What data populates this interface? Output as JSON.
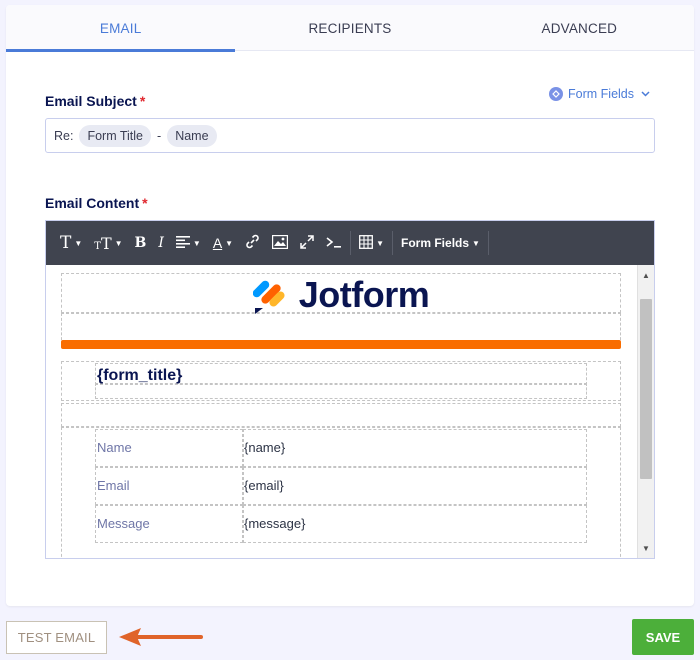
{
  "tabs": [
    {
      "label": "EMAIL",
      "active": true
    },
    {
      "label": "RECIPIENTS",
      "active": false
    },
    {
      "label": "ADVANCED",
      "active": false
    }
  ],
  "subject": {
    "label": "Email Subject",
    "required_mark": "*",
    "form_fields_label": "Form Fields",
    "prefix": "Re:",
    "chip_1": "Form Title",
    "separator": "-",
    "chip_2": "Name"
  },
  "content": {
    "label": "Email Content",
    "required_mark": "*",
    "toolbar": {
      "form_fields_label": "Form Fields",
      "icons": [
        "font-family",
        "font-size",
        "bold",
        "italic",
        "align",
        "font-color",
        "link",
        "image",
        "fullscreen",
        "code",
        "table",
        "form-fields"
      ]
    },
    "template": {
      "logo_text": "Jotform",
      "form_title": "{form_title}",
      "rows": [
        {
          "label": "Name",
          "value": "{name}"
        },
        {
          "label": "Email",
          "value": "{email}"
        },
        {
          "label": "Message",
          "value": "{message}"
        }
      ]
    }
  },
  "footer": {
    "test_email_label": "TEST EMAIL",
    "save_label": "SAVE"
  },
  "colors": {
    "accent": "#4a7bd8",
    "save": "#4caf3a",
    "orange": "#f96d00",
    "arrow": "#e0642a"
  }
}
